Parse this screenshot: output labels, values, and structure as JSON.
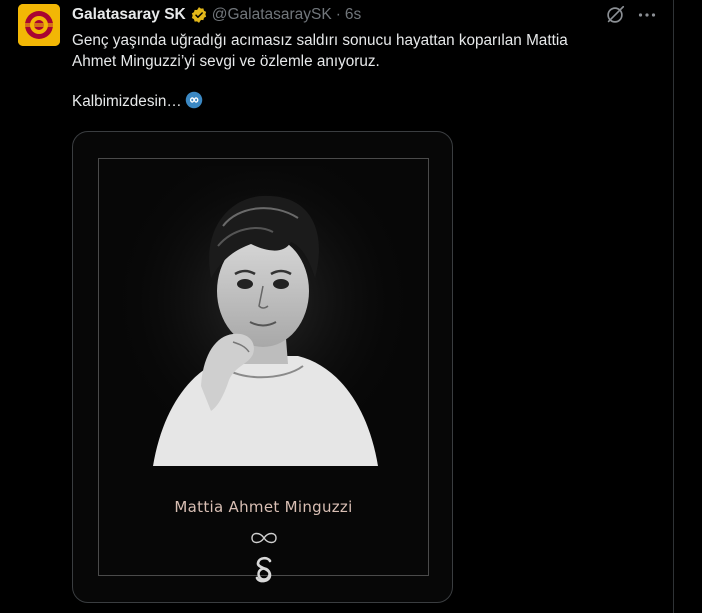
{
  "post": {
    "account_name": "Galatasaray SK",
    "handle": "@GalatasaraySK",
    "separator": "·",
    "time": "6s",
    "text_line1": "Genç yaşında uğradığı acımasız saldırı sonucu hayattan koparılan Mattia",
    "text_line2": "Ahmet Minguzzi’yi sevgi ve özlemle anıyoruz.",
    "text_line3": "Kalbimizdesin…"
  },
  "media": {
    "caption": "Mattia Ahmet Minguzzi"
  },
  "icons": {
    "verified": "verified-badge-icon",
    "grok": "grok-icon",
    "more": "more-options-icon",
    "infinity": "infinity-emoji-icon"
  },
  "colors": {
    "background": "#000000",
    "text": "#e7e9ea",
    "muted": "#71767b",
    "verified_gold": "#e2b719",
    "brand_yellow": "#f2b705",
    "brand_red": "#a90432",
    "caption": "#d9bfb4"
  }
}
